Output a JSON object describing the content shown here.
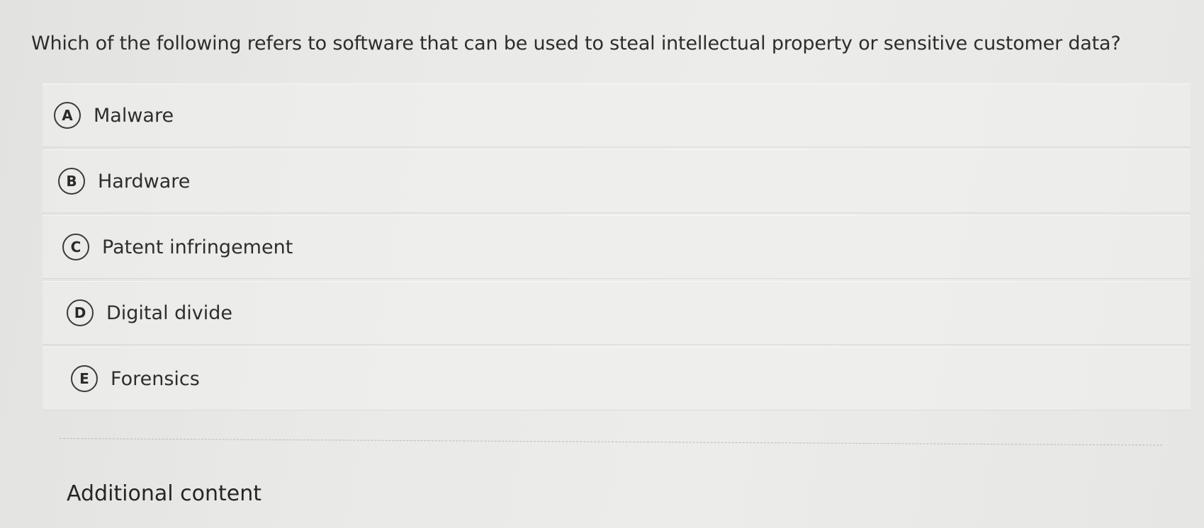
{
  "question": {
    "text": "Which of the following refers to software that can be used to steal intellectual property or sensitive customer data?"
  },
  "options": [
    {
      "letter": "A",
      "label": "Malware"
    },
    {
      "letter": "B",
      "label": "Hardware"
    },
    {
      "letter": "C",
      "label": "Patent infringement"
    },
    {
      "letter": "D",
      "label": "Digital divide"
    },
    {
      "letter": "E",
      "label": "Forensics"
    }
  ],
  "additional": {
    "heading": "Additional content"
  }
}
